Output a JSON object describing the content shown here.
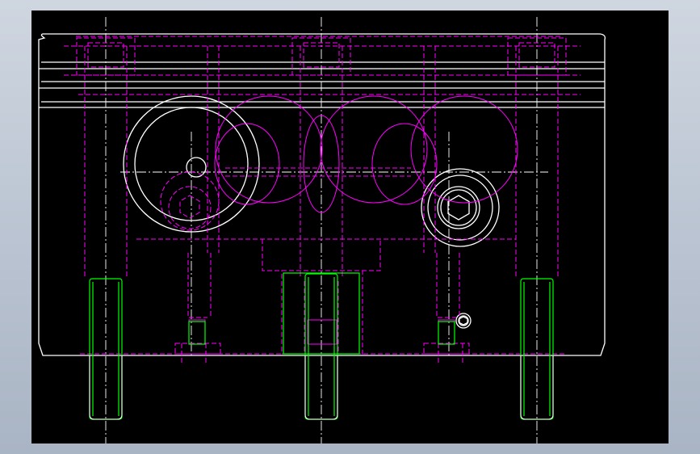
{
  "colors": {
    "background": "#000000",
    "frame": "#b9c3d1",
    "outline": "#ffffff",
    "hidden_lines": "#ff00ff",
    "pins": "#00ff00",
    "centerlines": "#ffffff"
  },
  "icons": {
    "hex_socket": "hex-socket-screw-icon",
    "small_screw": "small-hex-screw-icon"
  }
}
